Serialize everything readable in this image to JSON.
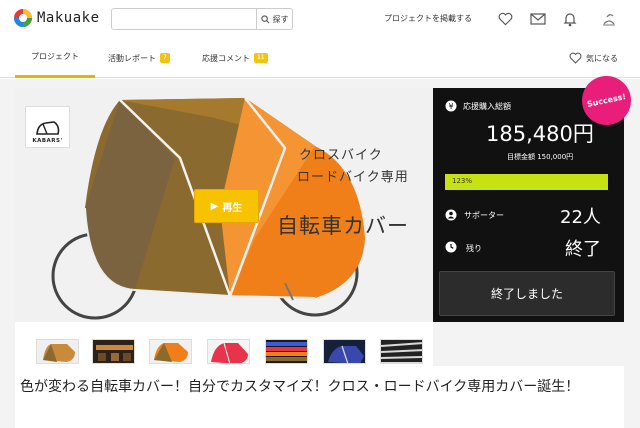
{
  "header": {
    "logo_text": "Makuake",
    "search_placeholder": "",
    "search_button": "探す",
    "post_project": "プロジェクトを掲載する",
    "icons": [
      "heart-icon",
      "mail-icon",
      "bell-icon",
      "user-icon"
    ]
  },
  "tabs": [
    {
      "label": "プロジェクト",
      "active": true
    },
    {
      "label": "活動レポート",
      "badge": "7"
    },
    {
      "label": "応援コメント",
      "badge": "11"
    }
  ],
  "favorite_label": "気になる",
  "main_image": {
    "brand": "KABARS'",
    "play_label": "再生",
    "overlay_line1": "クロスバイク",
    "overlay_line2": "ロードバイク専用",
    "overlay_line3": "自転車カバー"
  },
  "panel": {
    "badge": "Success!",
    "total_label": "応援購入総額",
    "total_amount": "185,480円",
    "goal": "目標金額 150,000円",
    "progress_text": "123%",
    "progress_fraction": 1.0,
    "supporters_label": "サポーター",
    "supporters_value": "22人",
    "remaining_label": "残り",
    "remaining_value": "終了",
    "end_button": "終了しました"
  },
  "thumbnails": [
    "cover-photo",
    "shop-photo",
    "orange-cover",
    "pink-cover",
    "fabric-swatches",
    "night-photo",
    "reflector-strips"
  ],
  "title": "色が変わる自転車カバー！自分でカスタマイズ！クロス・ロードバイク専用カバー誕生！",
  "colors": {
    "accent": "#e8b400",
    "progress": "#c6e212",
    "success": "#e91e7a",
    "panel": "#111111"
  }
}
